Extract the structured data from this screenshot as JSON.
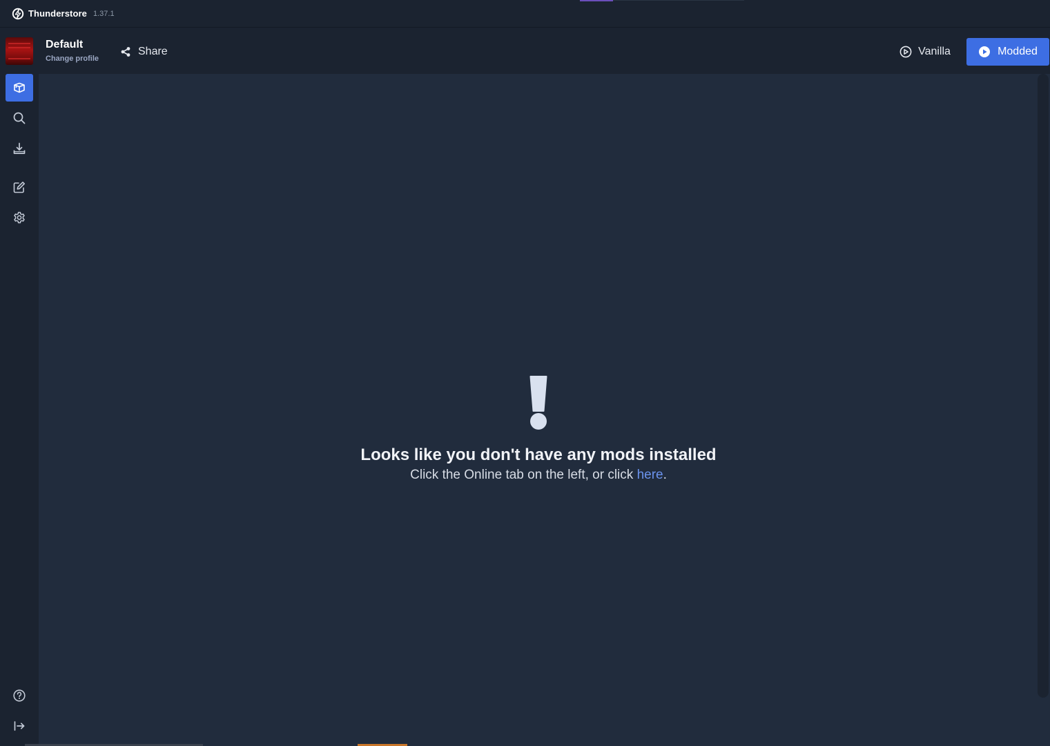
{
  "titlebar": {
    "app_name": "Thunderstore",
    "version": "1.37.1"
  },
  "profile": {
    "name": "Default",
    "change_label": "Change profile"
  },
  "header": {
    "share_label": "Share",
    "vanilla_label": "Vanilla",
    "modded_label": "Modded"
  },
  "sidebar": {
    "items": [
      {
        "name": "installed",
        "icon": "package-icon",
        "active": true
      },
      {
        "name": "online",
        "icon": "search-icon",
        "active": false
      },
      {
        "name": "downloads",
        "icon": "download-icon",
        "active": false
      },
      {
        "name": "config-editor",
        "icon": "edit-icon",
        "active": false
      },
      {
        "name": "settings",
        "icon": "gear-icon",
        "active": false
      },
      {
        "name": "help",
        "icon": "help-icon",
        "active": false
      },
      {
        "name": "exit",
        "icon": "exit-icon",
        "active": false
      }
    ]
  },
  "empty_state": {
    "icon": "exclamation-icon",
    "title": "Looks like you don't have any mods installed",
    "subtitle_prefix": "Click the Online tab on the left, or click ",
    "link_text": "here",
    "subtitle_suffix": "."
  },
  "colors": {
    "accent": "#3d6ee3",
    "background": "#1b2330",
    "content_background": "#212c3d",
    "link": "#6b93ee"
  }
}
